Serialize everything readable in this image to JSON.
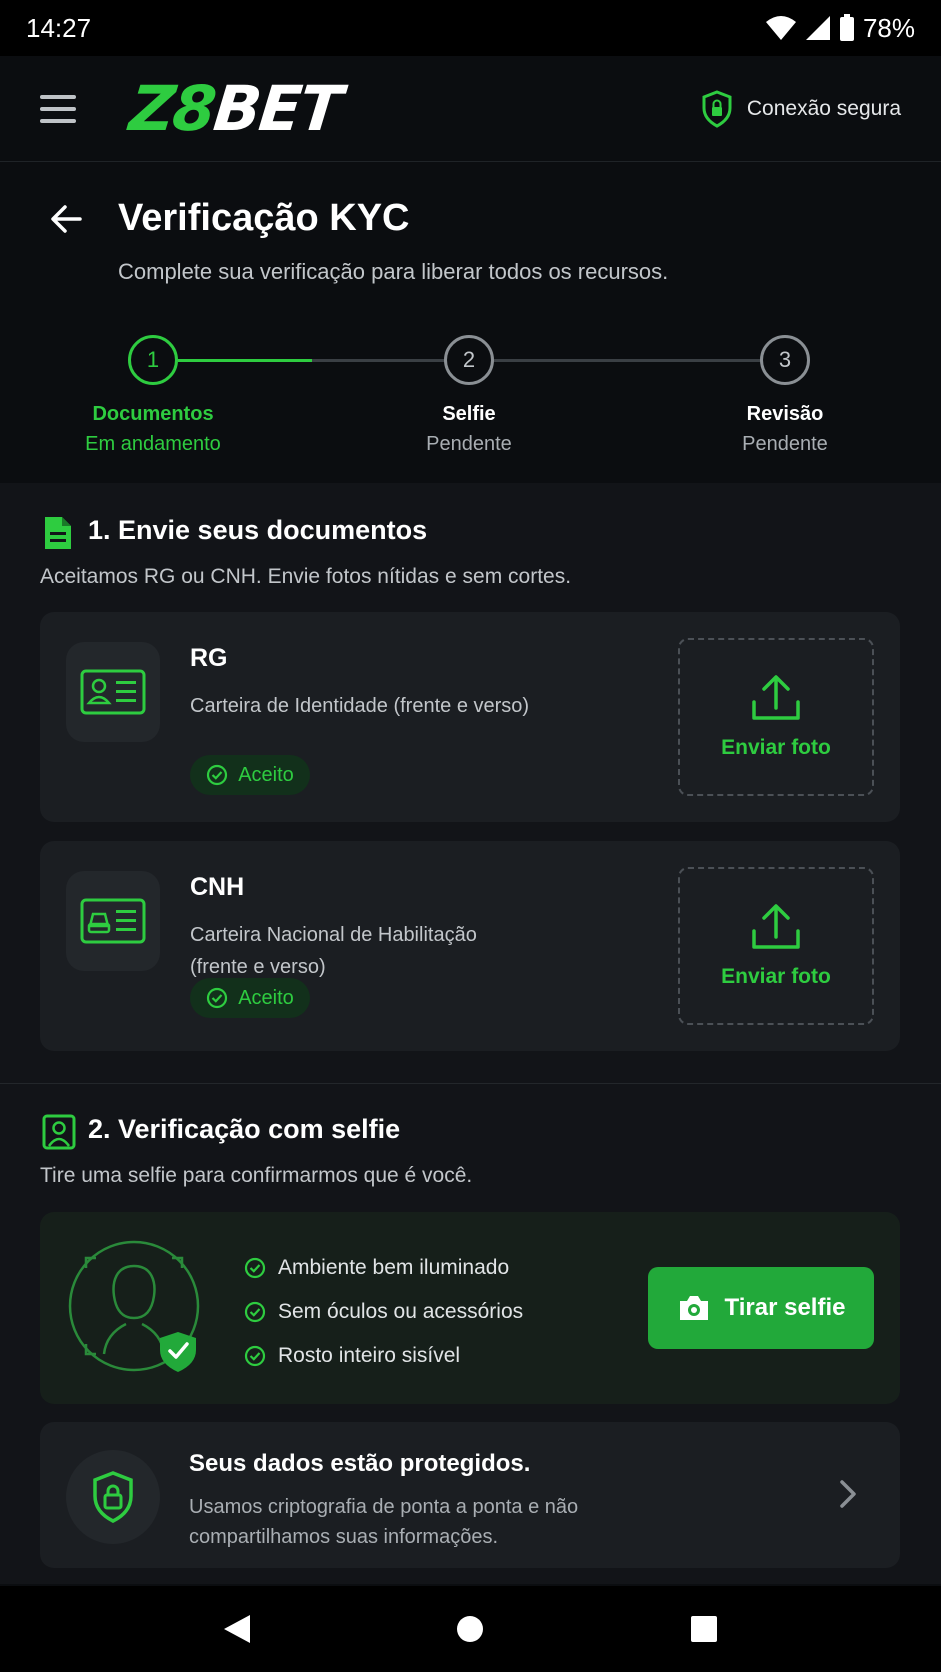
{
  "status_bar": {
    "time": "14:27",
    "battery": "78%"
  },
  "header": {
    "logo_green": "Z8",
    "logo_white": "BET",
    "secure_label": "Conexão segura"
  },
  "page": {
    "title": "Verificação KYC",
    "subtitle": "Complete sua verificação para liberar todos os recursos."
  },
  "steps": [
    {
      "number": "1",
      "label": "Documentos",
      "status": "Em andamento"
    },
    {
      "number": "2",
      "label": "Selfie",
      "status": "Pendente"
    },
    {
      "number": "3",
      "label": "Revisão",
      "status": "Pendente"
    }
  ],
  "documents": {
    "title": "1. Envie seus documentos",
    "description": "Aceitamos RG ou CNH. Envie fotos nítidas e sem cortes.",
    "items": [
      {
        "name": "RG",
        "description": "Carteira de Identidade (frente e verso)",
        "badge": "Aceito",
        "upload_label": "Enviar foto"
      },
      {
        "name": "CNH",
        "description": "Carteira Nacional de Habilitação (frente e verso)",
        "badge": "Aceito",
        "upload_label": "Enviar foto"
      }
    ]
  },
  "selfie": {
    "title": "2. Verificação com selfie",
    "description": "Tire uma selfie para confirmarmos que é você.",
    "checks": [
      "Ambiente bem iluminado",
      "Sem óculos ou acessórios",
      "Rosto inteiro sisível"
    ],
    "button_label": "Tirar selfie"
  },
  "protection": {
    "title": "Seus dados estão protegidos.",
    "description": "Usamos criptografia de ponta a ponta e não compartilhamos suas informações."
  },
  "colors": {
    "accent": "#2ecc40",
    "background": "#0b0d10",
    "card": "#1b1e22",
    "button": "#22a93a"
  }
}
